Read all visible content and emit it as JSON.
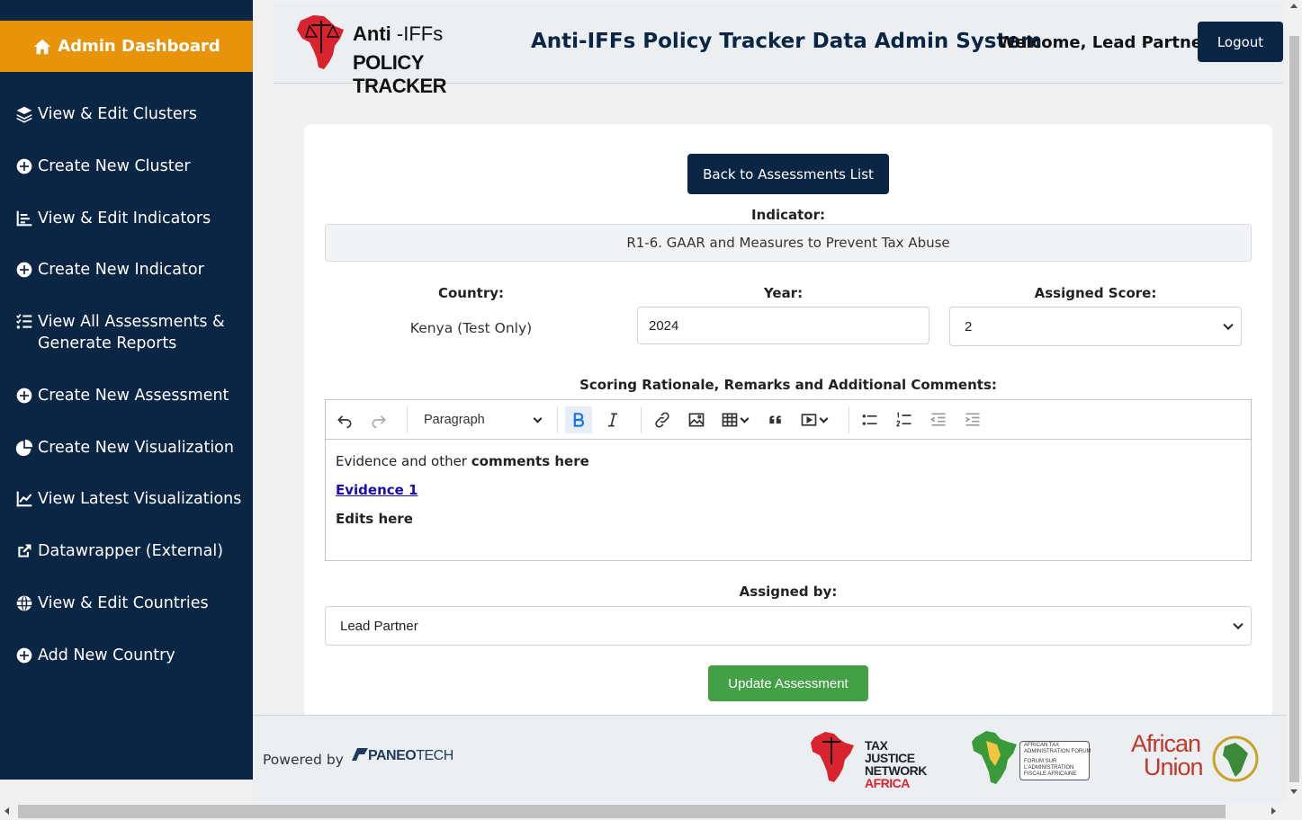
{
  "sidebar": {
    "header_label": "Admin Dashboard",
    "items": [
      {
        "label": "View & Edit Clusters",
        "icon": "layers-icon"
      },
      {
        "label": "Create New Cluster",
        "icon": "plus-circle-icon"
      },
      {
        "label": "View & Edit Indicators",
        "icon": "chart-bar-icon"
      },
      {
        "label": "Create New Indicator",
        "icon": "plus-circle-icon"
      },
      {
        "label": "View All Assessments & Generate Reports",
        "icon": "list-check-icon"
      },
      {
        "label": "Create New Assessment",
        "icon": "plus-circle-icon"
      },
      {
        "label": "Create New Visualization",
        "icon": "pie-chart-icon"
      },
      {
        "label": "View Latest Visualizations",
        "icon": "line-chart-icon"
      },
      {
        "label": "Datawrapper (External)",
        "icon": "external-link-icon"
      },
      {
        "label": "View & Edit Countries",
        "icon": "globe-icon"
      },
      {
        "label": "Add New Country",
        "icon": "plus-circle-icon"
      }
    ]
  },
  "header": {
    "logo_line1_prefix": "Anti",
    "logo_line1_suffix": "-IFFs",
    "logo_line2": "POLICY TRACKER",
    "title": "Anti-IFFs Policy Tracker Data Admin System",
    "welcome": "Welcome, Lead Partner!",
    "logout_label": "Logout"
  },
  "form": {
    "back_label": "Back to Assessments List",
    "indicator_label": "Indicator:",
    "indicator_value": "R1-6. GAAR and Measures to Prevent Tax Abuse",
    "country_label": "Country:",
    "country_value": "Kenya (Test Only)",
    "year_label": "Year:",
    "year_value": "2024",
    "score_label": "Assigned Score:",
    "score_value": "2",
    "rationale_label": "Scoring Rationale, Remarks and Additional Comments:",
    "editor_block_format": "Paragraph",
    "editor_line1_plain": "Evidence and other ",
    "editor_line1_bold": "comments here",
    "editor_link": "Evidence 1",
    "editor_line3": "Edits here",
    "assigned_by_label": "Assigned by:",
    "assigned_by_value": "Lead Partner",
    "update_label": "Update Assessment"
  },
  "footer": {
    "powered_by": "Powered by",
    "paneo_bold": "PANEO",
    "paneo_light": "TECH",
    "tjna_line1": "TAX JUSTICE",
    "tjna_line2": "NETWORK",
    "tjna_line3": "AFRICA",
    "ataf_line1": "AFRICAN TAX",
    "ataf_line2": "ADMINISTRATION FORUM",
    "ataf_line3": "FORUM SUR",
    "ataf_line4": "L'ADMINISTRATION",
    "ataf_line5": "FISCALE AFRICAINE",
    "au_line1": "African",
    "au_line2": "Union"
  },
  "colors": {
    "sidebar_bg": "#0b2545",
    "accent_orange": "#e8940b",
    "primary_button": "#0b2545",
    "success_button": "#43a047"
  }
}
